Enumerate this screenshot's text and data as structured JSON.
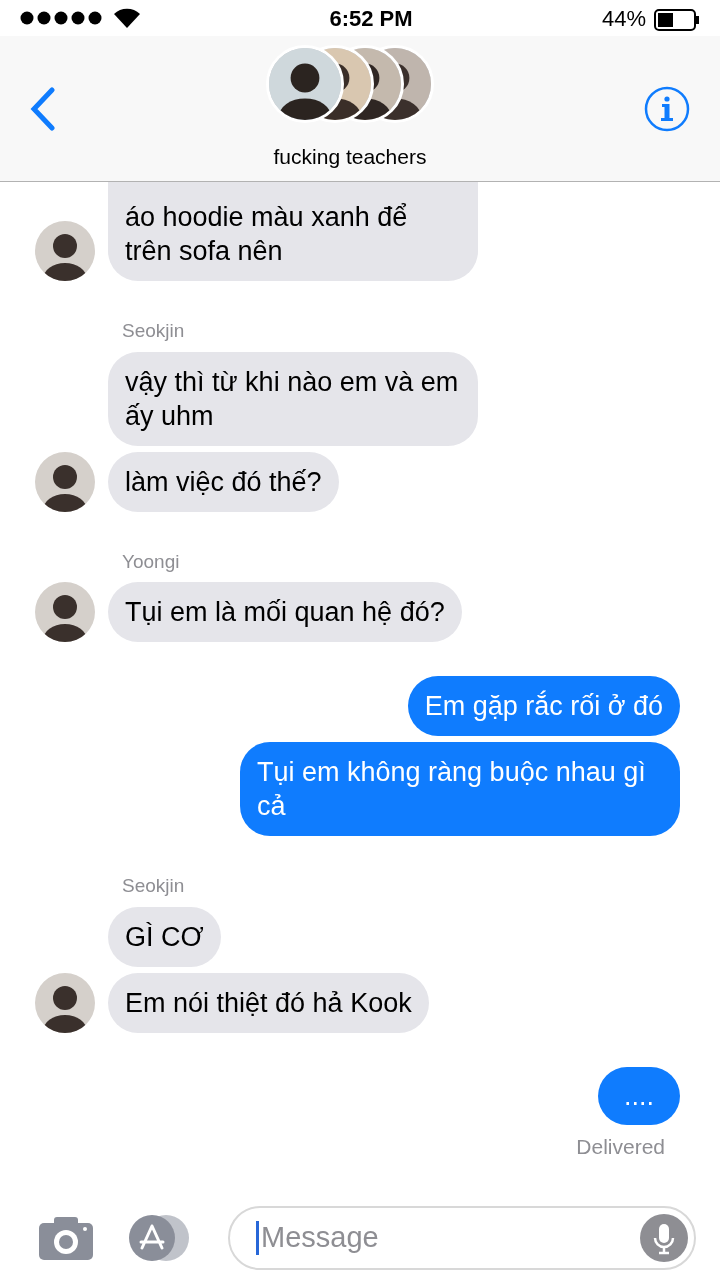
{
  "status_bar": {
    "time": "6:52 PM",
    "battery": "44%"
  },
  "header": {
    "title": "fucking teachers"
  },
  "messages": [
    {
      "kind": "incoming",
      "text": "áo hoodie màu xanh để trên sofa nên",
      "avatar": true
    },
    {
      "kind": "sender",
      "text": "Seokjin"
    },
    {
      "kind": "incoming",
      "text": "vậy thì từ khi nào em và em ấy uhm",
      "avatar": false
    },
    {
      "kind": "incoming",
      "text": "làm việc đó thế?",
      "avatar": true
    },
    {
      "kind": "sender",
      "text": "Yoongi"
    },
    {
      "kind": "incoming",
      "text": "Tụi em là mối quan hệ đó?",
      "avatar": true
    },
    {
      "kind": "outgoing",
      "text": "Em gặp rắc rối ở đó"
    },
    {
      "kind": "outgoing",
      "text": "Tụi em không ràng buộc nhau gì cả"
    },
    {
      "kind": "sender",
      "text": "Seokjin"
    },
    {
      "kind": "incoming",
      "text": "GÌ CƠ",
      "avatar": false
    },
    {
      "kind": "incoming",
      "text": "Em nói thiệt đó hả Kook",
      "avatar": true
    },
    {
      "kind": "outgoing",
      "text": "...."
    },
    {
      "kind": "status",
      "text": "Delivered"
    }
  ],
  "composer": {
    "placeholder": "Message"
  }
}
